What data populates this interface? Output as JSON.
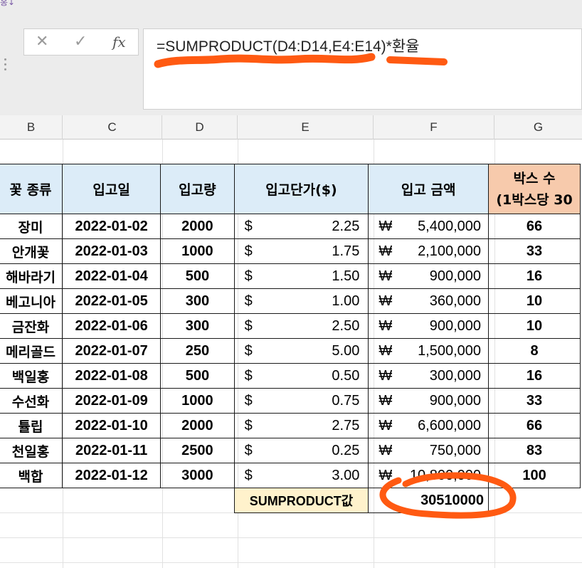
{
  "ribbon": {
    "fragment": "홍↓"
  },
  "formula_bar": {
    "cancel_glyph": "✕",
    "enter_glyph": "✓",
    "fx_label": "fx",
    "formula": "=SUMPRODUCT(D4:D14,E4:E14)*환율"
  },
  "columns": [
    "B",
    "C",
    "D",
    "E",
    "F",
    "G"
  ],
  "table": {
    "headers": {
      "flower": "꽃 종류",
      "date": "입고일",
      "qty": "입고량",
      "unit_price": "입고단가($)",
      "amount": "입고 금액",
      "box_line1": "박스 수",
      "box_line2": "(1박스당 30"
    },
    "currency_usd": "$",
    "currency_krw": "₩",
    "rows": [
      {
        "flower": "장미",
        "date": "2022-01-02",
        "qty": "2000",
        "price": "2.25",
        "amount": "5,400,000",
        "box": "66"
      },
      {
        "flower": "안개꽃",
        "date": "2022-01-03",
        "qty": "1000",
        "price": "1.75",
        "amount": "2,100,000",
        "box": "33"
      },
      {
        "flower": "해바라기",
        "date": "2022-01-04",
        "qty": "500",
        "price": "1.50",
        "amount": "900,000",
        "box": "16"
      },
      {
        "flower": "베고니아",
        "date": "2022-01-05",
        "qty": "300",
        "price": "1.00",
        "amount": "360,000",
        "box": "10"
      },
      {
        "flower": "금잔화",
        "date": "2022-01-06",
        "qty": "300",
        "price": "2.50",
        "amount": "900,000",
        "box": "10"
      },
      {
        "flower": "메리골드",
        "date": "2022-01-07",
        "qty": "250",
        "price": "5.00",
        "amount": "1,500,000",
        "box": "8"
      },
      {
        "flower": "백일홍",
        "date": "2022-01-08",
        "qty": "500",
        "price": "0.50",
        "amount": "300,000",
        "box": "16"
      },
      {
        "flower": "수선화",
        "date": "2022-01-09",
        "qty": "1000",
        "price": "0.75",
        "amount": "900,000",
        "box": "33"
      },
      {
        "flower": "튤립",
        "date": "2022-01-10",
        "qty": "2000",
        "price": "2.75",
        "amount": "6,600,000",
        "box": "66"
      },
      {
        "flower": "천일홍",
        "date": "2022-01-11",
        "qty": "2500",
        "price": "0.25",
        "amount": "750,000",
        "box": "83"
      },
      {
        "flower": "백합",
        "date": "2022-01-12",
        "qty": "3000",
        "price": "3.00",
        "amount": "10,800,000",
        "box": "100"
      }
    ],
    "sum_label": "SUMPRODUCT값",
    "sum_value": "30510000"
  },
  "colors": {
    "header_fill": "#dcecf8",
    "box_header_fill": "#f7caac",
    "sum_label_fill": "#fff2cc",
    "annotation_orange": "#ff5a12"
  }
}
